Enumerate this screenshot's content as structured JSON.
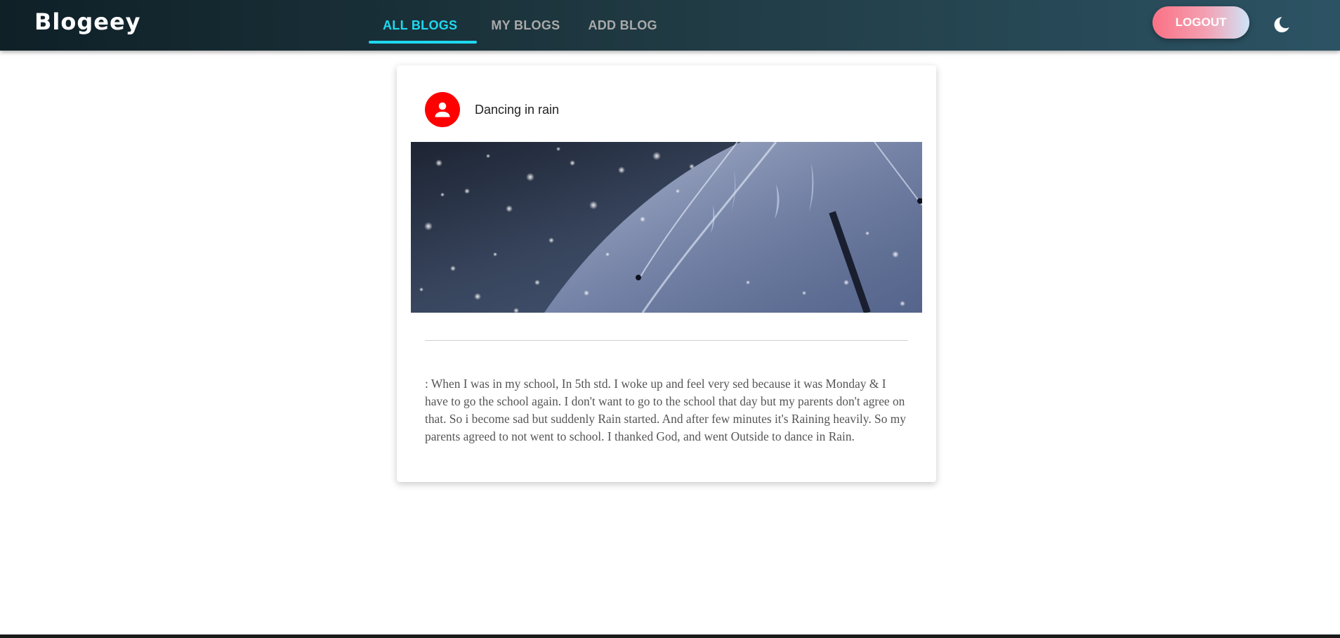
{
  "app": {
    "brand": "Blogeey"
  },
  "nav": {
    "tabs": [
      {
        "label": "ALL BLOGS",
        "active": true
      },
      {
        "label": "MY BLOGS",
        "active": false
      },
      {
        "label": "ADD BLOG",
        "active": false
      }
    ],
    "logout_label": "LOGOUT",
    "theme_icon": "moon-icon"
  },
  "post": {
    "avatar_icon": "person-icon",
    "title": "Dancing in rain",
    "image_alt": "rain-umbrella-image",
    "body": ": When I was in my school, In 5th std. I woke up and feel very sed because it was Monday & I have to go the school again. I don't want to go to the school that day but my parents don't agree on that. So i become sad but suddenly Rain started. And after few minutes it's Raining heavily. So my parents agreed to not went to school. I thanked God, and went Outside to dance in Rain."
  },
  "colors": {
    "accent": "#1fd8f0",
    "avatar": "#ff0000",
    "nav_inactive": "#a9a9a9"
  }
}
